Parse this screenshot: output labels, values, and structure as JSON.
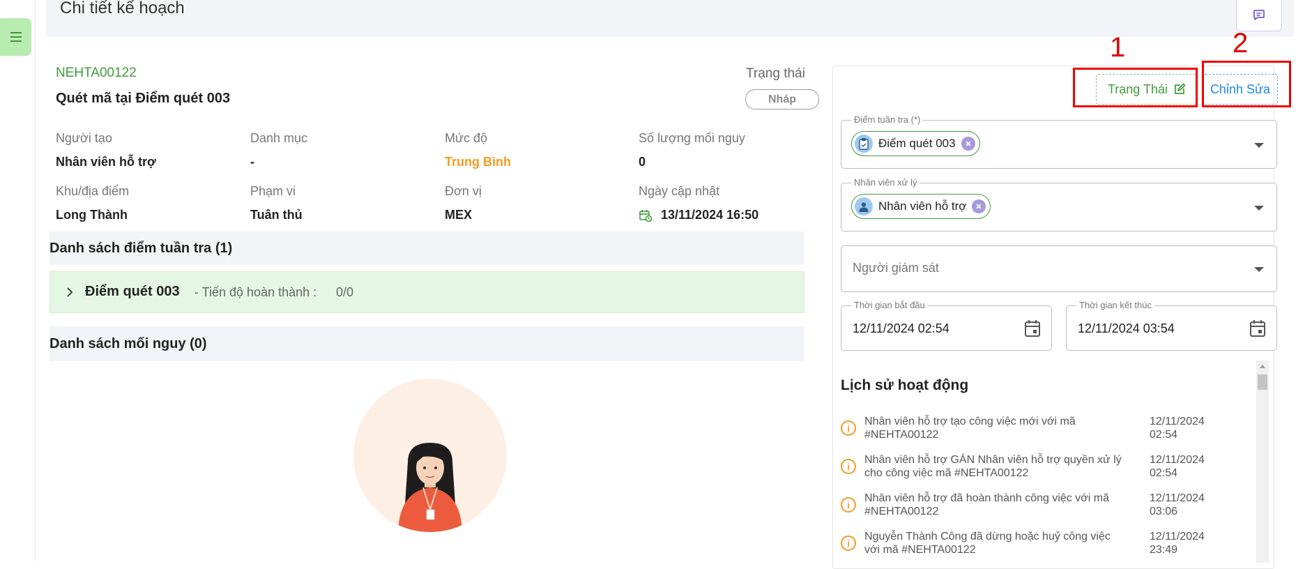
{
  "header": {
    "title": "Chi tiết kế hoạch"
  },
  "plan": {
    "code": "NEHTA00122",
    "title": "Quét mã tại Điểm quét 003",
    "status_label": "Trạng thái",
    "status_value": "Nháp"
  },
  "fields": [
    {
      "label": "Người tạo",
      "value": "Nhân viên hỗ trợ"
    },
    {
      "label": "Danh mục",
      "value": "-"
    },
    {
      "label": "Mức độ",
      "value": "Trung Bình"
    },
    {
      "label": "Số lượng mối nguy",
      "value": "0"
    },
    {
      "label": "Khu/địa điểm",
      "value": "Long Thành"
    },
    {
      "label": "Phạm vi",
      "value": "Tuân thủ"
    },
    {
      "label": "Đơn vị",
      "value": "MEX"
    },
    {
      "label": "Ngày cập nhật",
      "value": "13/11/2024 16:50"
    }
  ],
  "checkpoints": {
    "title": "Danh sách điểm tuần tra (1)",
    "items": [
      {
        "name": "Điểm quét 003",
        "progress_label": "- Tiến độ hoàn thành :",
        "progress_value": "0/0"
      }
    ]
  },
  "hazards": {
    "title": "Danh sách mối nguy (0)"
  },
  "panel": {
    "status_button": "Trạng Thái",
    "edit_button": "Chỉnh Sửa",
    "annotations": [
      "1",
      "2"
    ],
    "checkpoint_field": {
      "label": "Điểm tuần tra (*)",
      "chip": "Điểm quét 003"
    },
    "handler_field": {
      "label": "Nhân viên xử lý",
      "chip": "Nhân viên hỗ trợ"
    },
    "supervisor_field": {
      "placeholder": "Người giám sát"
    },
    "start_time": {
      "label": "Thời gian bắt đầu",
      "value": "12/11/2024 02:54"
    },
    "end_time": {
      "label": "Thời gian kết thúc",
      "value": "12/11/2024 03:54"
    }
  },
  "history": {
    "title": "Lịch sử hoạt động",
    "items": [
      {
        "text": "Nhân viên hỗ trợ tạo công việc mới với mã #NEHTA00122",
        "date": "12/11/2024",
        "time": "02:54"
      },
      {
        "text": "Nhân viên hỗ trợ GÁN Nhân viên hỗ trợ quyền xử lý cho công việc mã #NEHTA00122",
        "date": "12/11/2024",
        "time": "02:54"
      },
      {
        "text": "Nhân viên hỗ trợ đã hoàn thành công việc với mã #NEHTA00122",
        "date": "12/11/2024",
        "time": "03:06"
      },
      {
        "text": "Nguyễn Thành Công đã dừng hoặc huỷ công việc với mã #NEHTA00122",
        "date": "12/11/2024",
        "time": "23:49"
      }
    ]
  },
  "colors": {
    "accent_green": "#3e9b3a",
    "accent_blue": "#1e88e5",
    "warning_orange": "#f59a23",
    "annotation_red": "#f00000"
  },
  "icons": [
    "menu-icon",
    "chat-icon",
    "calendar-clock-icon",
    "chevron-right-icon",
    "edit-icon",
    "clipboard-icon",
    "user-icon",
    "close-icon",
    "dropdown-arrow-icon",
    "calendar-icon",
    "info-icon"
  ]
}
